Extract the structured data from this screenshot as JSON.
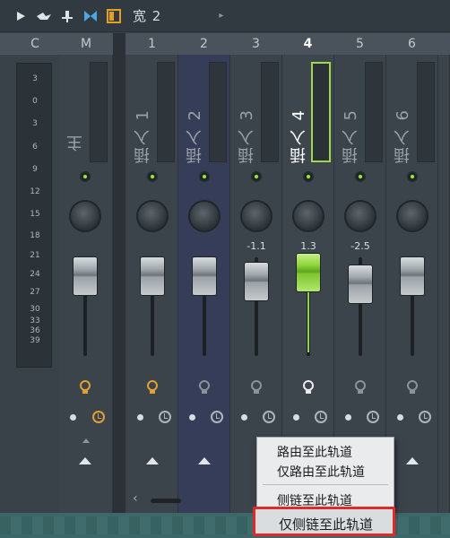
{
  "toolbar": {
    "title": "宽 2",
    "icons": [
      "arrow-right-icon",
      "bird-icon",
      "pin-icon",
      "bowtie-icon",
      "square-panel-icon"
    ],
    "arrow": "▸"
  },
  "header": {
    "columns": [
      "C",
      "M",
      "1",
      "2",
      "3",
      "4",
      "5",
      "6"
    ],
    "active_column": "4"
  },
  "meter": {
    "ticks": [
      "3",
      "0",
      "3",
      "6",
      "9",
      "12",
      "15",
      "18",
      "21",
      "24",
      "27",
      "30",
      "33",
      "36",
      "39"
    ]
  },
  "strips": [
    {
      "id": "M",
      "name": "主",
      "pan": ""
    },
    {
      "id": "1",
      "name": "插入 1",
      "pan": ""
    },
    {
      "id": "2",
      "name": "插入 2",
      "pan": ""
    },
    {
      "id": "3",
      "name": "插入 3",
      "pan": "-1.1"
    },
    {
      "id": "4",
      "name": "插入 4",
      "pan": "1.3"
    },
    {
      "id": "5",
      "name": "插入 5",
      "pan": "-2.5"
    },
    {
      "id": "6",
      "name": "插入 6",
      "pan": ""
    }
  ],
  "context_menu": {
    "items": [
      "路由至此轨道",
      "仅路由至此轨道",
      "侧链至此轨道",
      "仅侧链至此轨道"
    ],
    "highlighted": "仅侧链至此轨道"
  },
  "scroll": {
    "left_arrow": "‹"
  },
  "colors": {
    "accent_green": "#8fd93e",
    "highlight_red": "#e02a2a",
    "orange": "#e0a033"
  }
}
